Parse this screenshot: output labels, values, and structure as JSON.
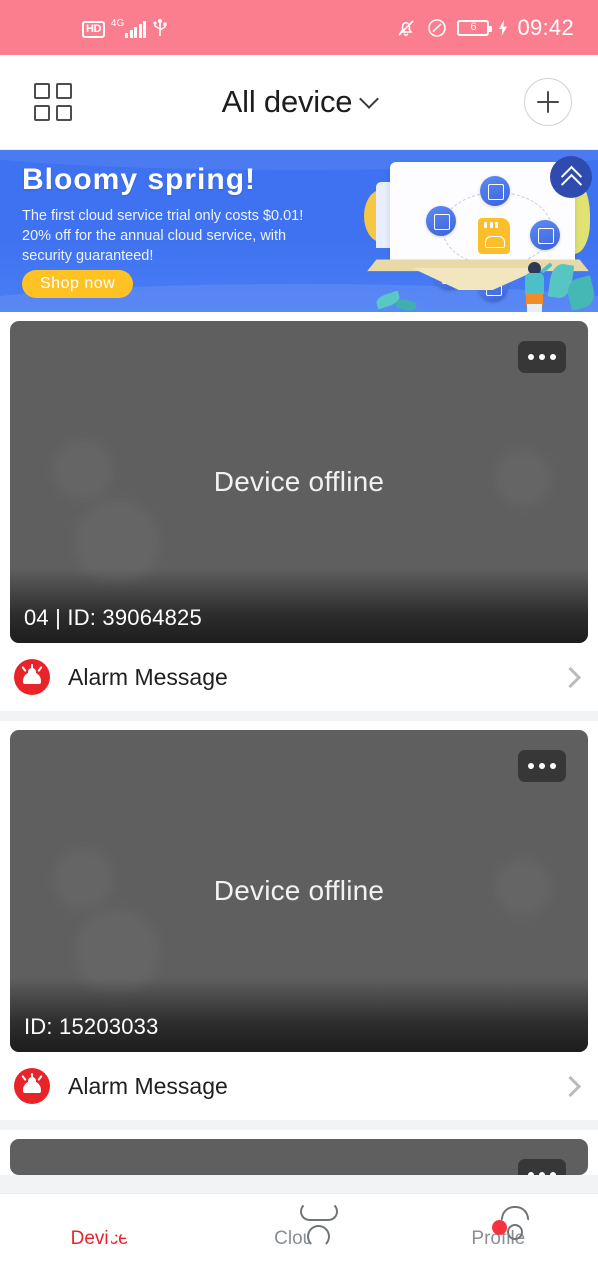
{
  "statusbar": {
    "hd_label": "HD",
    "network_label": "4G",
    "usb_icon": "usb-icon",
    "mute_icon": "bell-muted-icon",
    "data_saver_icon": "data-saver-icon",
    "battery_level": "6",
    "charging_icon": "charging-bolt-icon",
    "time": "09:42",
    "background_color": "#fb7e8e"
  },
  "header": {
    "grid_icon": "grid-view-icon",
    "title": "All device",
    "chevron_icon": "chevron-down-icon",
    "add_icon": "plus-icon"
  },
  "banner": {
    "title": "Bloomy  spring!",
    "line1": "The first cloud service trial only costs $0.01!",
    "line2": "20% off for the annual cloud service, with",
    "line3": " security guaranteed!",
    "cta_label": "Shop now",
    "collapse_icon": "double-chevron-up-icon",
    "background_color": "#3f72f0",
    "cta_color": "#ffc225"
  },
  "devices": [
    {
      "status_text": "Device offline",
      "label": "04 | ID: 39064825",
      "menu_icon": "more-options-icon",
      "alarm": {
        "icon": "alarm-siren-icon",
        "label": "Alarm Message",
        "chevron": "chevron-right-icon"
      }
    },
    {
      "status_text": "Device offline",
      "label": "ID: 15203033",
      "menu_icon": "more-options-icon",
      "alarm": {
        "icon": "alarm-siren-icon",
        "label": "Alarm Message",
        "chevron": "chevron-right-icon"
      }
    }
  ],
  "tabbar": {
    "items": [
      {
        "label": "Device",
        "icon": "camera-lens-icon",
        "active": true,
        "badge": false
      },
      {
        "label": "Cloud",
        "icon": "cloud-icon",
        "active": false,
        "badge": false
      },
      {
        "label": "Profile",
        "icon": "person-icon",
        "active": false,
        "badge": true
      }
    ],
    "active_color": "#e8232a",
    "inactive_color": "#8a8f94"
  }
}
